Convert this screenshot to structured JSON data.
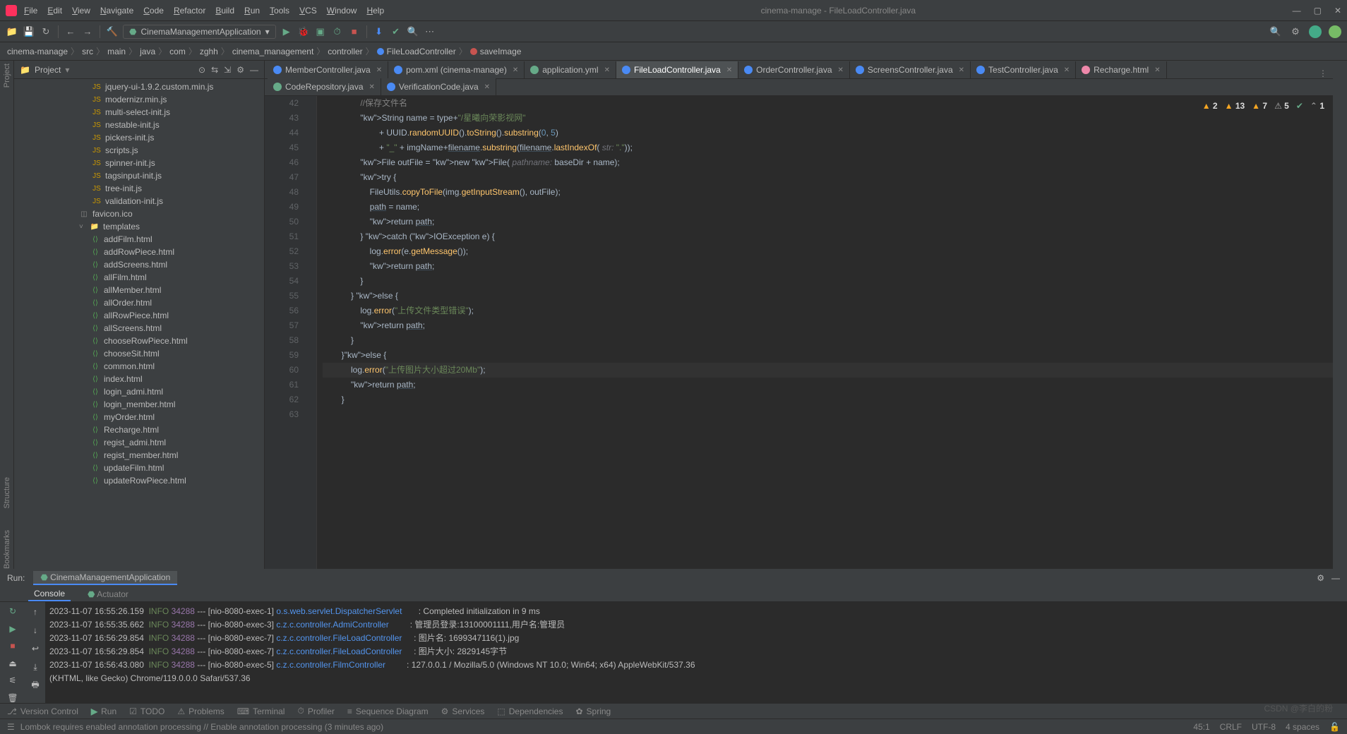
{
  "title": "cinema-manage - FileLoadController.java",
  "menu": [
    "File",
    "Edit",
    "View",
    "Navigate",
    "Code",
    "Refactor",
    "Build",
    "Run",
    "Tools",
    "VCS",
    "Window",
    "Help"
  ],
  "runconfig": "CinemaManagementApplication",
  "breadcrumb": [
    "cinema-manage",
    "src",
    "main",
    "java",
    "com",
    "zghh",
    "cinema_management",
    "controller",
    "FileLoadController",
    "saveImage"
  ],
  "projectTitle": "Project",
  "tree": {
    "jsFiles": [
      "jquery-ui-1.9.2.custom.min.js",
      "modernizr.min.js",
      "multi-select-init.js",
      "nestable-init.js",
      "pickers-init.js",
      "scripts.js",
      "spinner-init.js",
      "tagsinput-init.js",
      "tree-init.js",
      "validation-init.js"
    ],
    "favicon": "favicon.ico",
    "templatesFolder": "templates",
    "templates": [
      "addFilm.html",
      "addRowPiece.html",
      "addScreens.html",
      "allFilm.html",
      "allMember.html",
      "allOrder.html",
      "allRowPiece.html",
      "allScreens.html",
      "chooseRowPiece.html",
      "chooseSit.html",
      "common.html",
      "index.html",
      "login_admi.html",
      "login_member.html",
      "myOrder.html",
      "Recharge.html",
      "regist_admi.html",
      "regist_member.html",
      "updateFilm.html",
      "updateRowPiece.html"
    ]
  },
  "tabsRow1": [
    {
      "label": "MemberController.java",
      "color": "#4a8af4"
    },
    {
      "label": "pom.xml (cinema-manage)",
      "color": "#4a8af4"
    },
    {
      "label": "application.yml",
      "color": "#6a8"
    },
    {
      "label": "FileLoadController.java",
      "color": "#4a8af4",
      "active": true
    },
    {
      "label": "OrderController.java",
      "color": "#4a8af4"
    },
    {
      "label": "ScreensController.java",
      "color": "#4a8af4"
    },
    {
      "label": "TestController.java",
      "color": "#4a8af4"
    },
    {
      "label": "Recharge.html",
      "color": "#e8a"
    }
  ],
  "tabsRow2": [
    {
      "label": "CodeRepository.java",
      "color": "#6a8"
    },
    {
      "label": "VerificationCode.java",
      "color": "#4a8af4"
    }
  ],
  "hints": {
    "warn1": "2",
    "warn2": "13",
    "warn3": "7",
    "weak": "5",
    "up": "^",
    "down": "1"
  },
  "code": {
    "startLine": 42,
    "lines": [
      "                //保存文件名",
      "                String name = type+\"/星曦向荣影视网\"",
      "                        + UUID.randomUUID().toString().substring(0, 5)",
      "                        + \"_\" + imgName+filename.substring(filename.lastIndexOf( str: \".\"));",
      "                File outFile = new File( pathname: baseDir + name);",
      "                try {",
      "                    FileUtils.copyToFile(img.getInputStream(), outFile);",
      "                    path = name;",
      "                    return path;",
      "                } catch (IOException e) {",
      "                    log.error(e.getMessage());",
      "                    return path;",
      "                }",
      "",
      "            } else {",
      "                log.error(\"上传文件类型错误\");",
      "                return path;",
      "            }",
      "        }else {",
      "            log.error(\"上传图片大小超过20Mb\");",
      "            return path;",
      "        }"
    ]
  },
  "run": {
    "label": "Run:",
    "app": "CinemaManagementApplication",
    "tabs": [
      "Console",
      "Actuator"
    ],
    "logs": [
      {
        "ts": "2023-11-07 16:55:26.159",
        "lvl": "INFO",
        "pid": "34288",
        "thread": "[nio-8080-exec-1]",
        "logger": "o.s.web.servlet.DispatcherServlet",
        "msg": ": Completed initialization in 9 ms"
      },
      {
        "ts": "2023-11-07 16:55:35.662",
        "lvl": "INFO",
        "pid": "34288",
        "thread": "[nio-8080-exec-3]",
        "logger": "c.z.c.controller.AdmiController",
        "msg": ": 管理员登录:13100001111,用户名:管理员"
      },
      {
        "ts": "2023-11-07 16:56:29.854",
        "lvl": "INFO",
        "pid": "34288",
        "thread": "[nio-8080-exec-7]",
        "logger": "c.z.c.controller.FileLoadController",
        "msg": ": 图片名: 1699347116(1).jpg"
      },
      {
        "ts": "2023-11-07 16:56:29.854",
        "lvl": "INFO",
        "pid": "34288",
        "thread": "[nio-8080-exec-7]",
        "logger": "c.z.c.controller.FileLoadController",
        "msg": ": 图片大小: 2829145字节"
      },
      {
        "ts": "2023-11-07 16:56:43.080",
        "lvl": "INFO",
        "pid": "34288",
        "thread": "[nio-8080-exec-5]",
        "logger": "c.z.c.controller.FilmController",
        "msg": ": 127.0.0.1 / Mozilla/5.0 (Windows NT 10.0; Win64; x64) AppleWebKit/537.36"
      }
    ],
    "wrap": "(KHTML, like Gecko) Chrome/119.0.0.0 Safari/537.36"
  },
  "bottom": [
    "Version Control",
    "Run",
    "TODO",
    "Problems",
    "Terminal",
    "Profiler",
    "Sequence Diagram",
    "Services",
    "Dependencies",
    "Spring"
  ],
  "status": {
    "msg": "Lombok requires enabled annotation processing // Enable annotation processing (3 minutes ago)",
    "pos": "45:1",
    "eol": "CRLF",
    "enc": "UTF-8",
    "indent": "4 spaces"
  },
  "watermark": "CSDN @李白的粉"
}
